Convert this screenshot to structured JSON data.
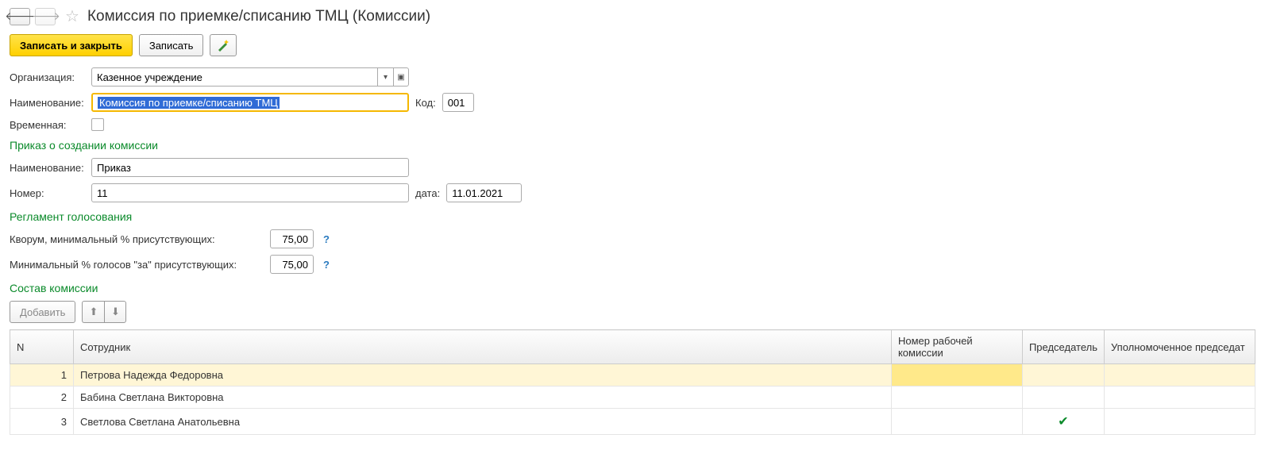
{
  "header": {
    "title": "Комиссия по приемке/списанию ТМЦ (Комиссии)"
  },
  "toolbar": {
    "save_close": "Записать и закрыть",
    "save": "Записать"
  },
  "form": {
    "org_label": "Организация:",
    "org_value": "Казенное учреждение",
    "name_label": "Наименование:",
    "name_value": "Комиссия по приемке/списанию ТМЦ",
    "code_label": "Код:",
    "code_value": "001",
    "temp_label": "Временная:"
  },
  "sections": {
    "order_title": "Приказ о создании комиссии",
    "order_name_label": "Наименование:",
    "order_name_value": "Приказ",
    "order_no_label": "Номер:",
    "order_no_value": "11",
    "order_date_label": "дата:",
    "order_date_value": "11.01.2021",
    "voting_title": "Регламент голосования",
    "quorum_label": "Кворум, минимальный % присутствующих:",
    "quorum_value": "75,00",
    "min_votes_label": "Минимальный % голосов \"за\" присутствующих:",
    "min_votes_value": "75,00",
    "members_title": "Состав комиссии"
  },
  "members_toolbar": {
    "add": "Добавить"
  },
  "table": {
    "headers": {
      "n": "N",
      "employee": "Сотрудник",
      "work_no": "Номер рабочей комиссии",
      "chair": "Председатель",
      "auth_chair": "Уполномоченное председат"
    },
    "rows": [
      {
        "n": "1",
        "employee": "Петрова Надежда Федоровна",
        "work_no": "",
        "chair": false
      },
      {
        "n": "2",
        "employee": "Бабина Светлана Викторовна",
        "work_no": "",
        "chair": false
      },
      {
        "n": "3",
        "employee": "Светлова Светлана Анатольевна",
        "work_no": "",
        "chair": true
      }
    ]
  }
}
